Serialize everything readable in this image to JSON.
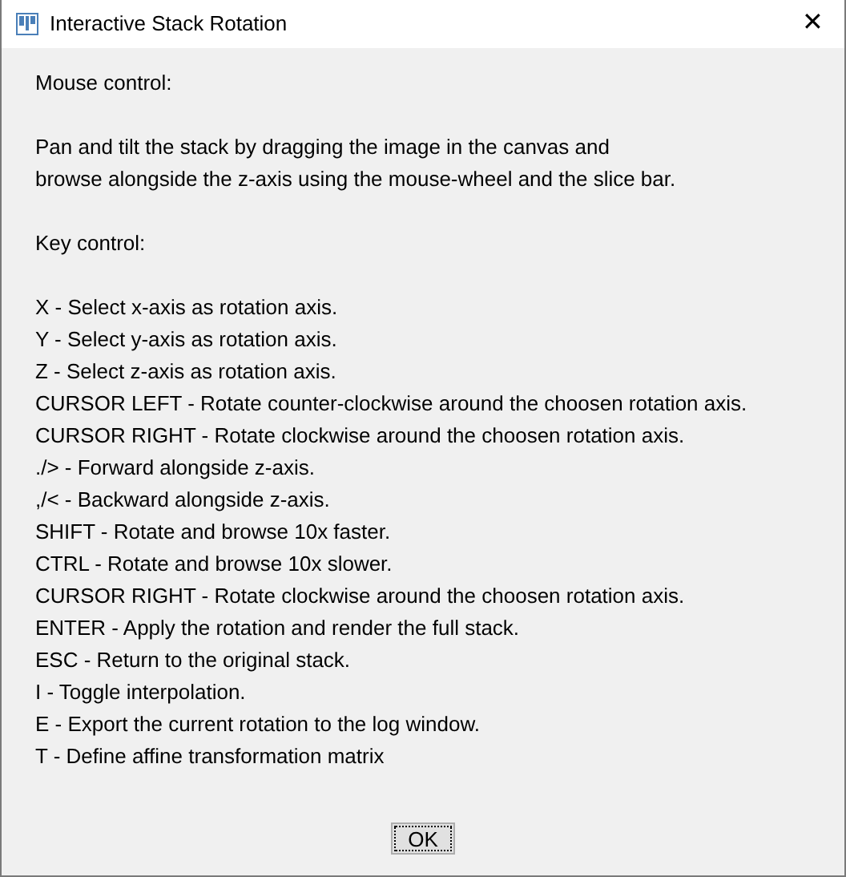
{
  "window": {
    "title": "Interactive Stack Rotation",
    "close": "✕"
  },
  "sections": [
    {
      "heading": "Mouse control:",
      "lines": [
        "Pan and tilt the stack by dragging the image in the canvas and",
        "browse alongside the z-axis using the mouse-wheel and the slice bar."
      ]
    },
    {
      "heading": "Key control:",
      "lines": [
        "X - Select x-axis as rotation axis.",
        "Y - Select y-axis as rotation axis.",
        "Z - Select z-axis as rotation axis.",
        "CURSOR LEFT - Rotate counter-clockwise around the choosen rotation axis.",
        "CURSOR RIGHT - Rotate clockwise around the choosen rotation axis.",
        "./> - Forward alongside z-axis.",
        ",/< - Backward alongside z-axis.",
        "SHIFT - Rotate and browse 10x faster.",
        "CTRL - Rotate and browse 10x slower.",
        "CURSOR RIGHT - Rotate clockwise around the choosen rotation axis.",
        "ENTER - Apply the rotation and render the full stack.",
        "ESC - Return to the original stack.",
        "I - Toggle interpolation.",
        "E - Export the current rotation to the log window.",
        "T - Define affine transformation matrix"
      ]
    }
  ],
  "buttons": [
    "OK"
  ]
}
